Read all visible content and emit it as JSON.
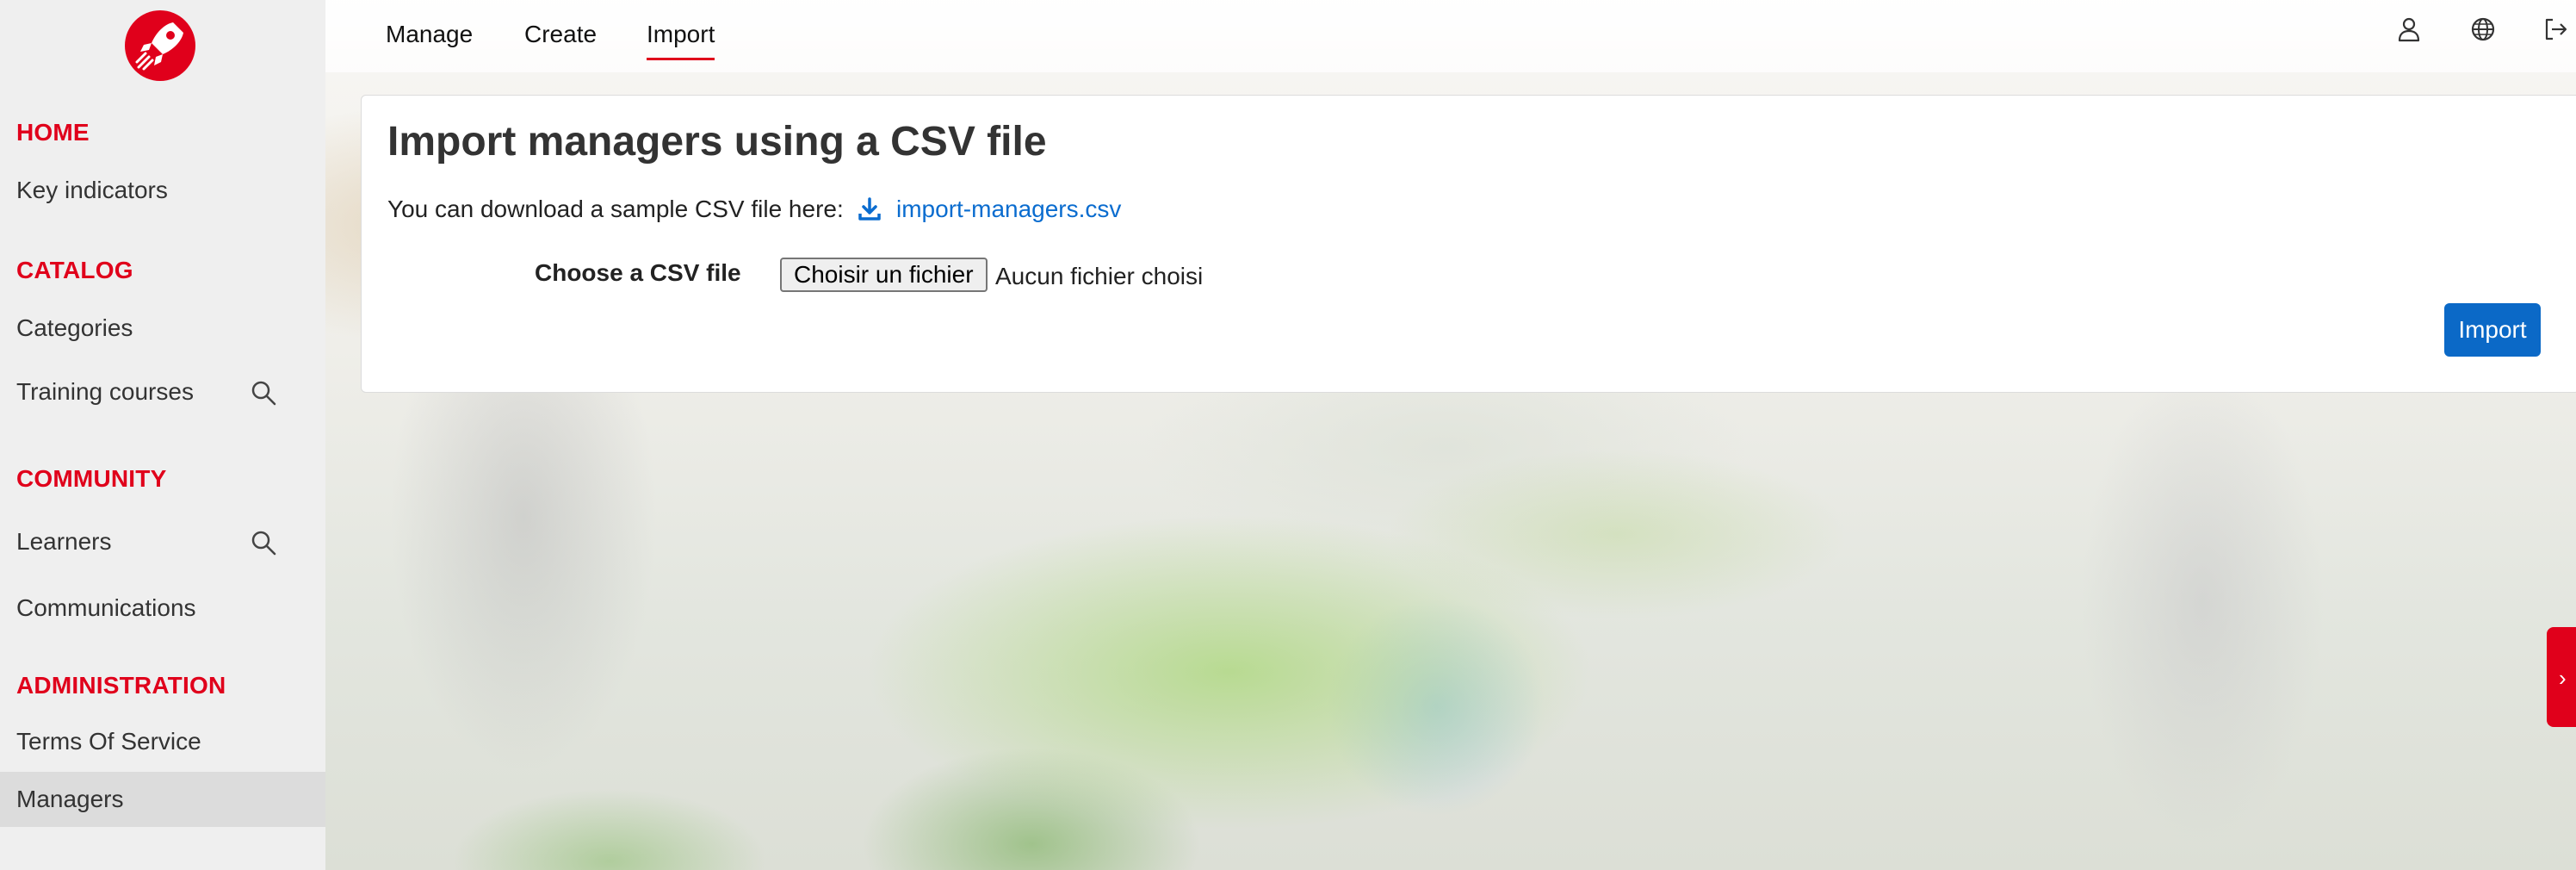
{
  "sidebar": {
    "logo": "rocket-logo",
    "sections": [
      {
        "title": "HOME",
        "items": [
          {
            "label": "Key indicators"
          }
        ]
      },
      {
        "title": "CATALOG",
        "items": [
          {
            "label": "Categories"
          },
          {
            "label": "Training courses",
            "icon": "search-icon"
          }
        ]
      },
      {
        "title": "COMMUNITY",
        "items": [
          {
            "label": "Learners",
            "icon": "search-icon"
          },
          {
            "label": "Communications"
          }
        ]
      },
      {
        "title": "ADMINISTRATION",
        "items": [
          {
            "label": "Terms Of Service"
          },
          {
            "label": "Managers",
            "active": true
          }
        ]
      }
    ]
  },
  "topbar": {
    "tabs": [
      {
        "label": "Manage"
      },
      {
        "label": "Create"
      },
      {
        "label": "Import",
        "active": true
      }
    ],
    "icons": [
      "user-icon",
      "globe-icon",
      "logout-icon"
    ]
  },
  "main": {
    "title": "Import managers using a CSV file",
    "sample_text": "You can download a sample CSV file here:",
    "sample_link": "import-managers.csv",
    "choose_label": "Choose a CSV file",
    "file_button": "Choisir un fichier",
    "file_status": "Aucun fichier choisi",
    "import_button": "Import"
  },
  "colors": {
    "accent": "#e0001b",
    "primary": "#0b69c7",
    "link": "#0a6ccf"
  }
}
